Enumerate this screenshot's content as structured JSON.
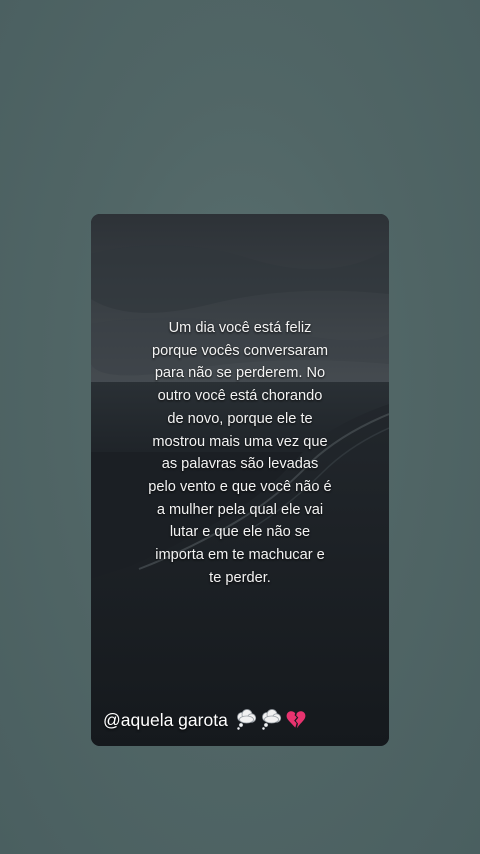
{
  "post": {
    "quote_lines": [
      "Um dia você está feliz",
      "porque vocês conversaram",
      "para não se perderem. No",
      "outro você está chorando",
      "de novo, porque ele te",
      "mostrou mais uma vez que",
      "as palavras são levadas",
      "pelo vento e que você não é",
      "a mulher pela qual ele vai",
      "lutar e que ele não se",
      "importa em te machucar e",
      "te perder."
    ],
    "handle": "@aquela garota",
    "emojis": [
      "thought-balloon-icon",
      "thought-balloon-icon",
      "broken-heart-icon"
    ]
  },
  "colors": {
    "page_background": "#516666",
    "card_background": "#1b1f24",
    "text": "#f4f4f4",
    "broken_heart": "#e8336f"
  }
}
